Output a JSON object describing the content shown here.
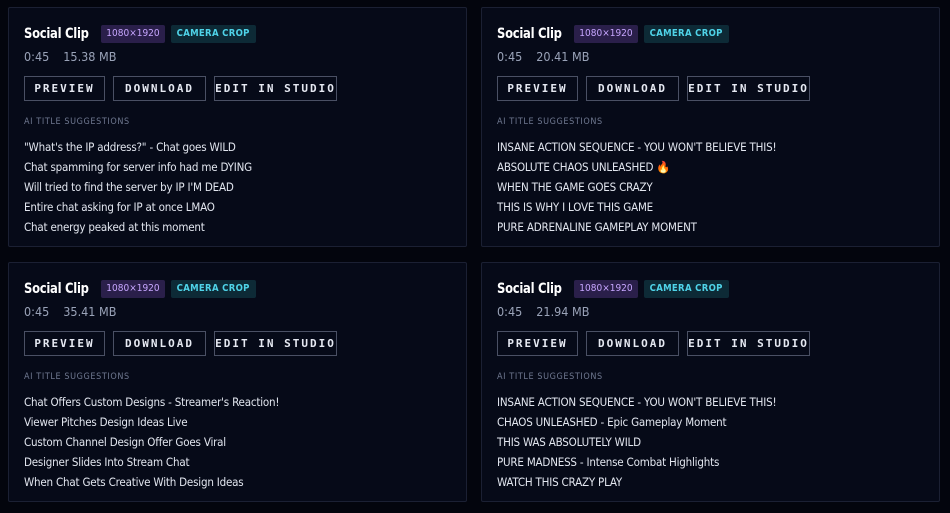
{
  "common": {
    "section_label": "AI TITLE SUGGESTIONS",
    "preview_label": "PREVIEW",
    "download_label": "DOWNLOAD",
    "studio_label": "EDIT IN STUDIO"
  },
  "clips": [
    {
      "title": "Social Clip",
      "resolution": "1080×1920",
      "crop": "CAMERA CROP",
      "duration": "0:45",
      "size": "15.38 MB",
      "suggestions": [
        "\"What's the IP address?\" - Chat goes WILD",
        "Chat spamming for server info had me DYING",
        "Will tried to find the server by IP I'M DEAD",
        "Entire chat asking for IP at once LMAO",
        "Chat energy peaked at this moment"
      ]
    },
    {
      "title": "Social Clip",
      "resolution": "1080×1920",
      "crop": "CAMERA CROP",
      "duration": "0:45",
      "size": "20.41 MB",
      "suggestions": [
        "INSANE ACTION SEQUENCE - YOU WON'T BELIEVE THIS!",
        "ABSOLUTE CHAOS UNLEASHED 🔥",
        "WHEN THE GAME GOES CRAZY",
        "THIS IS WHY I LOVE THIS GAME",
        "PURE ADRENALINE GAMEPLAY MOMENT"
      ]
    },
    {
      "title": "Social Clip",
      "resolution": "1080×1920",
      "crop": "CAMERA CROP",
      "duration": "0:45",
      "size": "35.41 MB",
      "suggestions": [
        "Chat Offers Custom Designs - Streamer's Reaction!",
        "Viewer Pitches Design Ideas Live",
        "Custom Channel Design Offer Goes Viral",
        "Designer Slides Into Stream Chat",
        "When Chat Gets Creative With Design Ideas"
      ]
    },
    {
      "title": "Social Clip",
      "resolution": "1080×1920",
      "crop": "CAMERA CROP",
      "duration": "0:45",
      "size": "21.94 MB",
      "suggestions": [
        "INSANE ACTION SEQUENCE - YOU WON'T BELIEVE THIS!",
        "CHAOS UNLEASHED - Epic Gameplay Moment",
        "THIS WAS ABSOLUTELY WILD",
        "PURE MADNESS - Intense Combat Highlights",
        "WATCH THIS CRAZY PLAY"
      ]
    }
  ],
  "colors": {
    "background": "#03050d",
    "card": "#060a18",
    "resolution_badge": "#2a1f4a",
    "crop_badge": "#0d2a36"
  }
}
